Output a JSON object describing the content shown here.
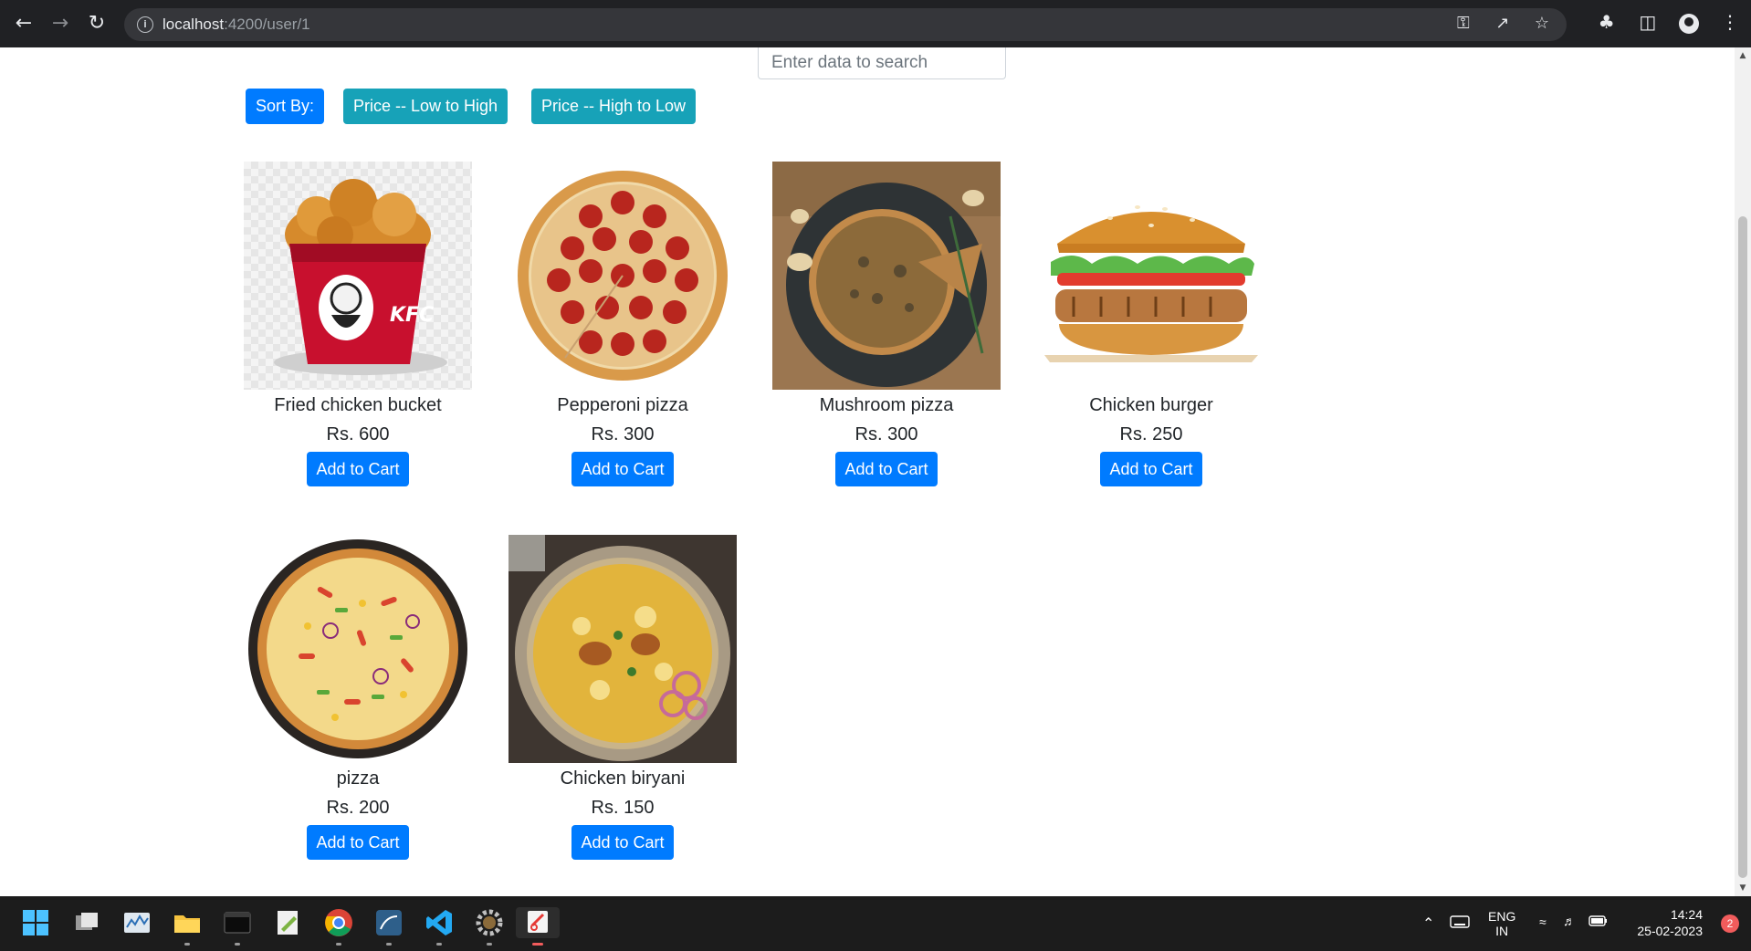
{
  "browser": {
    "url_host": "localhost",
    "url_path": ":4200/user/1",
    "info_icon": "info-icon"
  },
  "search": {
    "placeholder": "Enter data to search"
  },
  "sort": {
    "label": "Sort By:",
    "low_to_high": "Price -- Low to High",
    "high_to_low": "Price -- High to Low"
  },
  "products": [
    {
      "name": "Fried chicken bucket",
      "price": "Rs. 600",
      "cart_label": "Add to Cart",
      "image": "fried-chicken-bucket-image"
    },
    {
      "name": "Pepperoni pizza",
      "price": "Rs. 300",
      "cart_label": "Add to Cart",
      "image": "pepperoni-pizza-image"
    },
    {
      "name": "Mushroom pizza",
      "price": "Rs. 300",
      "cart_label": "Add to Cart",
      "image": "mushroom-pizza-image"
    },
    {
      "name": "Chicken burger",
      "price": "Rs. 250",
      "cart_label": "Add to Cart",
      "image": "chicken-burger-image"
    },
    {
      "name": "pizza",
      "price": "Rs. 200",
      "cart_label": "Add to Cart",
      "image": "pizza-image"
    },
    {
      "name": "Chicken biryani",
      "price": "Rs. 150",
      "cart_label": "Add to Cart",
      "image": "chicken-biryani-image"
    }
  ],
  "taskbar": {
    "lang_top": "ENG",
    "lang_bottom": "IN",
    "time": "14:24",
    "date": "25-02-2023",
    "notifications": "2"
  },
  "colors": {
    "primary": "#007bff",
    "info": "#17a2b8",
    "chrome": "#202124",
    "taskbar": "#1c1c1c"
  }
}
